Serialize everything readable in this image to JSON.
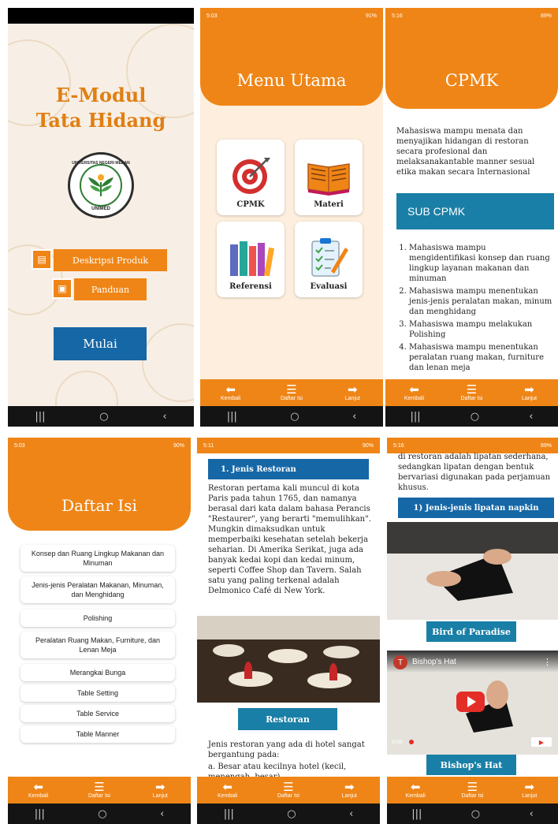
{
  "colors": {
    "orange": "#ef8516",
    "blue": "#1667a6",
    "teal": "#1a7fa6",
    "cream": "#f7efe6"
  },
  "navbar": {
    "recent": "|||",
    "home": "○",
    "back": "‹"
  },
  "bottombar": {
    "kembali": "Kembali",
    "daftar": "Daftar Isi",
    "lanjut": "Lanjut",
    "icons": [
      "arrow-left-icon",
      "list-icon",
      "arrow-right-icon"
    ]
  },
  "screen1": {
    "title_line1": "E-Modul",
    "title_line2": "Tata Hidang",
    "logo_top": "UNIVERSITAS NEGERI MEDAN",
    "logo_bottom": "UNIMED",
    "btn_deskripsi": "Deskripsi Produk",
    "btn_panduan": "Panduan",
    "btn_mulai": "Mulai"
  },
  "screen2": {
    "status_time": "5:03",
    "status_right": "91%",
    "header": "Menu Utama",
    "cards": [
      "CPMK",
      "Materi",
      "Referensi",
      "Evaluasi"
    ]
  },
  "screen3": {
    "status_time": "5:16",
    "status_right": "89%",
    "header": "CPMK",
    "intro": "Mahasiswa mampu menata dan menyajikan hidangan di restoran secara profesional dan melaksanakantable manner sesual etika makan secara Internasional",
    "sub_title": "SUB CPMK",
    "sub_items": [
      "Mahasiswa mampu mengidentifikasi konsep dan ruang lingkup layanan makanan dan minuman",
      "Mahasiswa mampu menentukan jenis-jenis peralatan makan, minum dan menghidang",
      "Mahasiswa mampu melakukan Polishing",
      "Mahasiswa mampu menentukan peralatan ruang makan, furniture dan lenan meja"
    ]
  },
  "screen4": {
    "status_time": "5:03",
    "status_right": "90%",
    "header": "Daftar Isi",
    "items": [
      "Konsep dan Ruang Lingkup Makanan dan Minuman",
      "Jenis-jenis Peralatan Makanan, Minuman, dan Menghidang",
      "Polishing",
      "Peralatan Ruang Makan, Furniture, dan Lenan Meja",
      "Merangkai Bunga",
      "Table Setting",
      "Table Service",
      "Table Manner"
    ]
  },
  "screen5": {
    "status_time": "5:11",
    "status_right": "90%",
    "section": "1. Jenis Restoran",
    "para": "Restoran pertama kali muncul di kota Paris pada tahun 1765, dan namanya berasal dari kata dalam bahasa Perancis \"Restaurer\", yang berarti \"memulihkan\". Mungkin dimaksudkan untuk memperbaiki kesehatan setelah bekerja seharian. Di Amerika Serikat, juga ada banyak kedai kopi dan kedai minum, seperti Coffee Shop dan Tavern. Salah satu yang paling terkenal adalah Delmonico Café di New York.",
    "caption": "Restoran",
    "para2": "Jenis restoran yang ada di hotel sangat bergantung pada:",
    "list_a": "a. Besar atau kecilnya hotel (kecil, menengah, besar)"
  },
  "screen6": {
    "status_time": "5:16",
    "status_right": "89%",
    "top_text": "di restoran adalah lipatan sederhana, sedangkan lipatan dengan bentuk bervariasi digunakan pada perjamuan khusus.",
    "section": "1) Jenis-jenis lipatan napkin",
    "caption1": "Bird of Paradise",
    "video_avatar": "T",
    "video_title": "Bishop's Hat",
    "video_time": "0:00",
    "caption2": "Bishop's Hat"
  }
}
